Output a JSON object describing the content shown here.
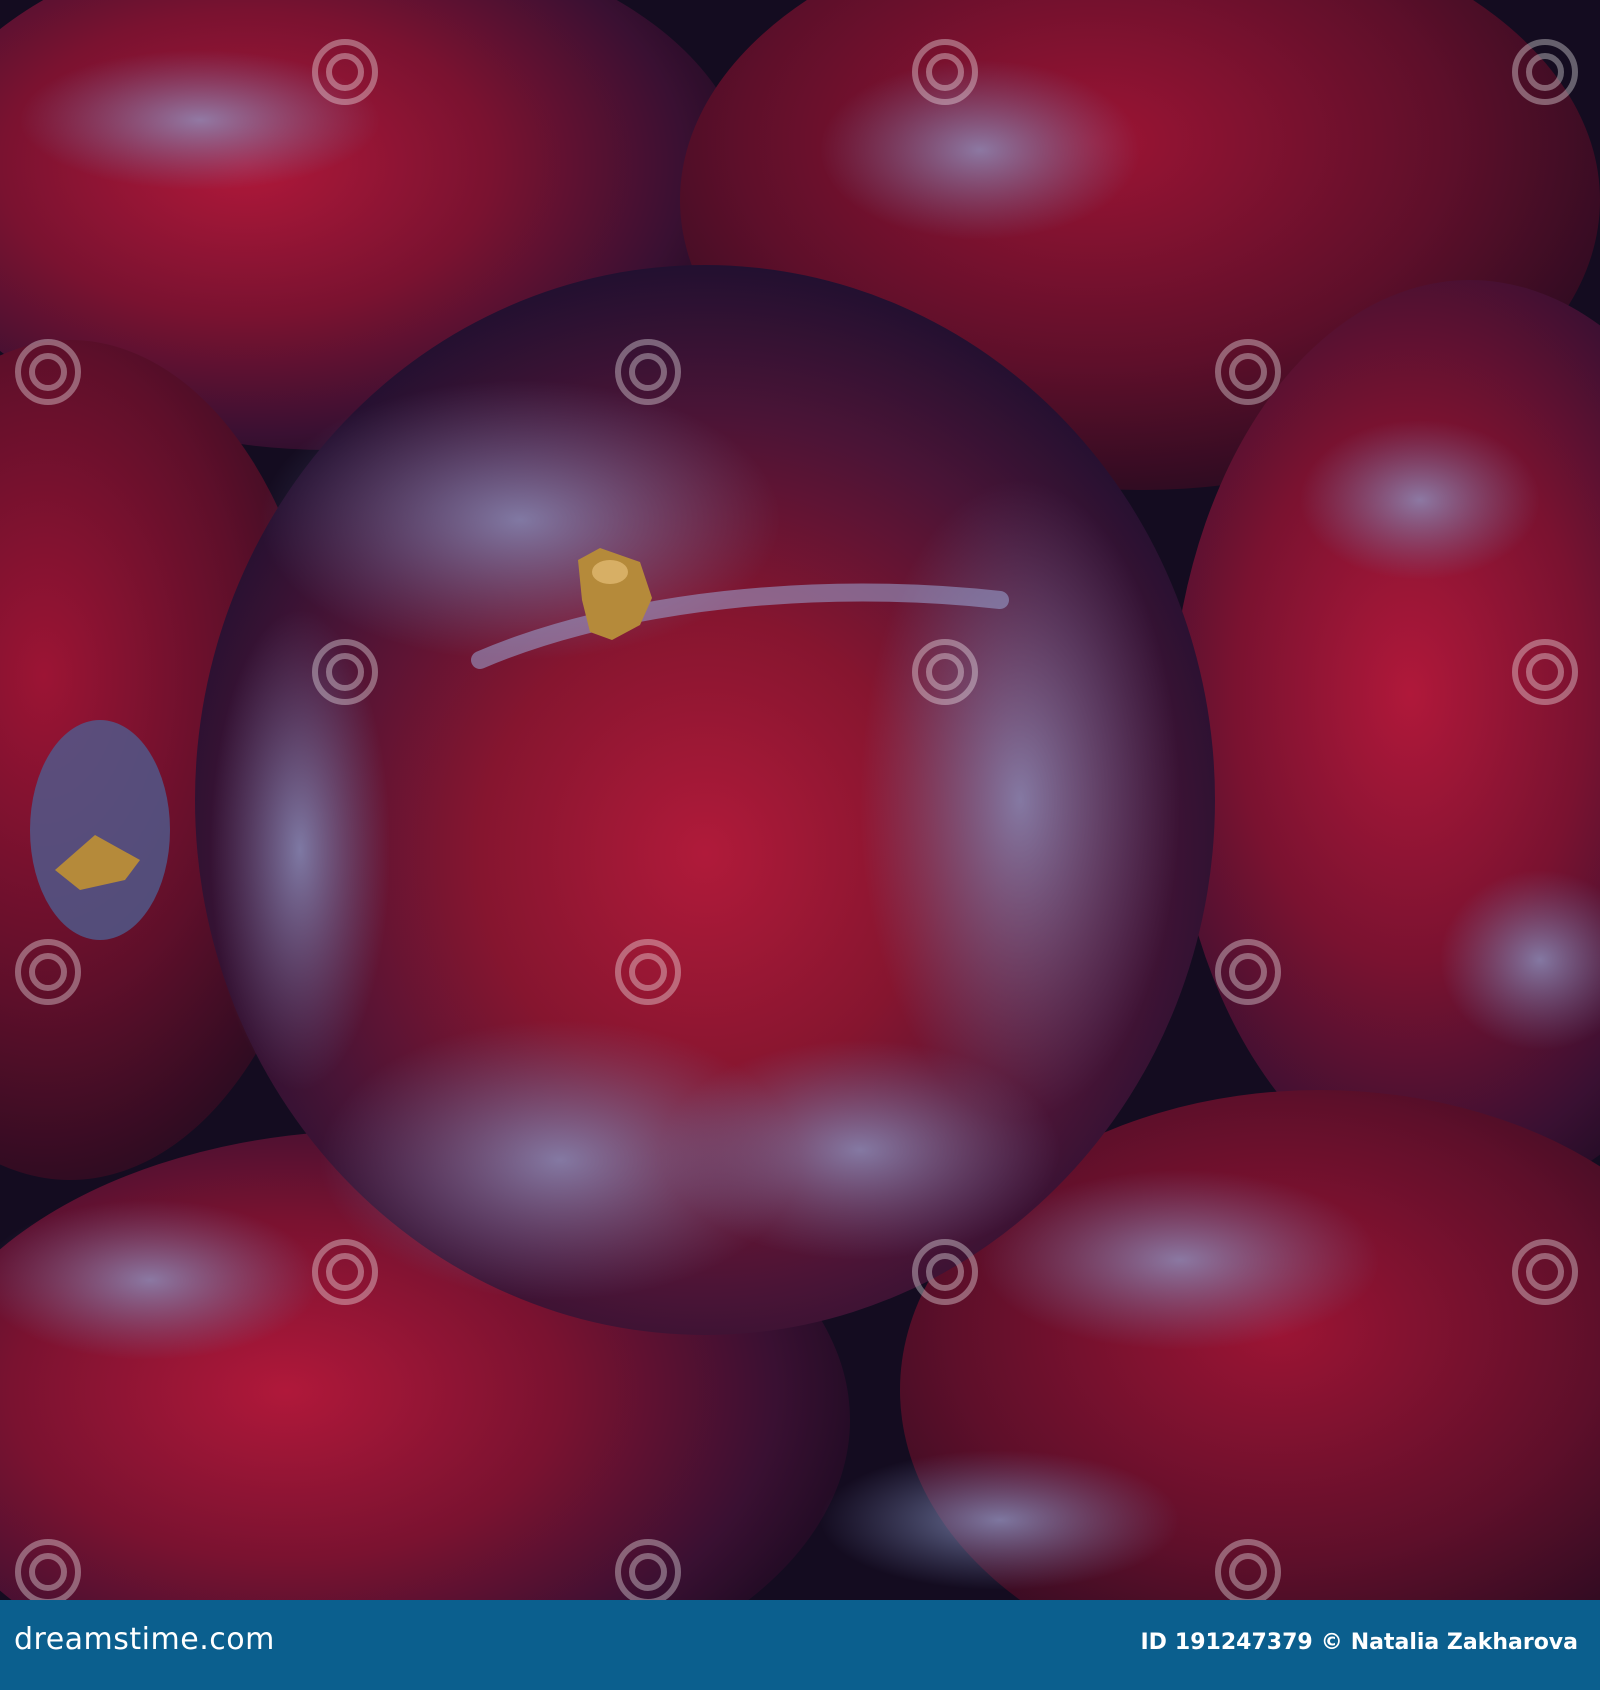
{
  "photo": {
    "subject": "plum-fruits-closeup",
    "watermark_text": "dreamstime",
    "colors": {
      "plum_red": "#8a1430",
      "plum_dark": "#2a0f2a",
      "bloom": "#6e7aa8",
      "stem": "#b58a3a"
    }
  },
  "footer": {
    "brand": "dreamstime.com",
    "id_label": "ID",
    "id_value": "191247379",
    "copyright_symbol": "©",
    "author": "Natalia Zakharova",
    "background_color": "#0b5f8e"
  }
}
